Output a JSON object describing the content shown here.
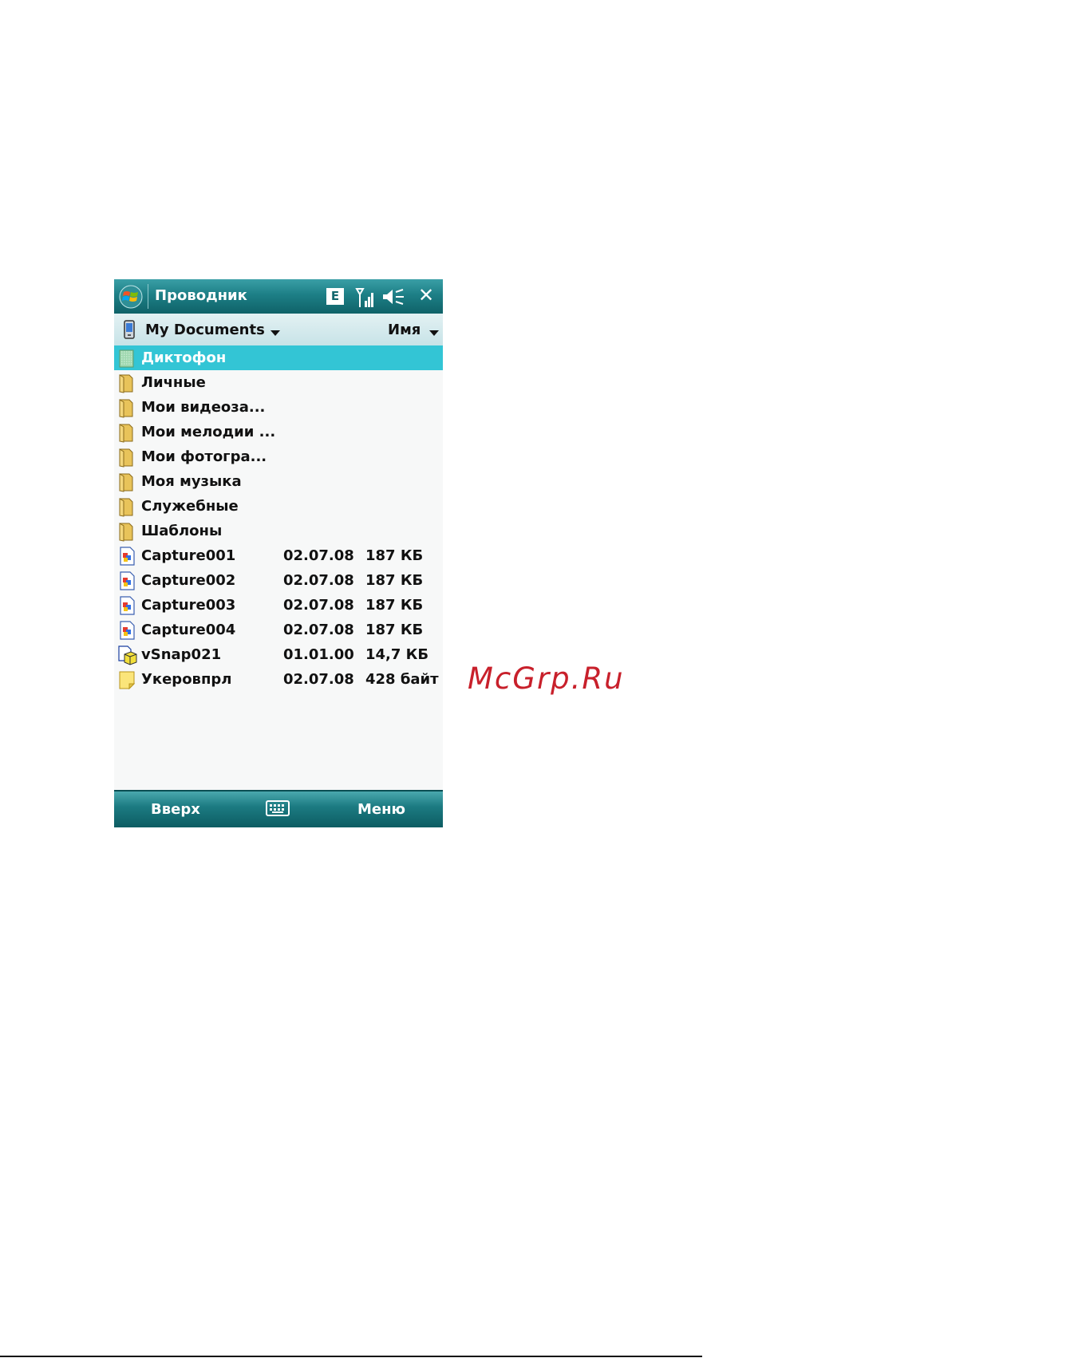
{
  "window": {
    "title": "Проводник",
    "tray_network_label": "E"
  },
  "location": {
    "folder": "My Documents",
    "sort_by": "Имя"
  },
  "files": [
    {
      "name": "Диктофон",
      "date": "",
      "size": "",
      "type": "recorder-folder",
      "selected": true
    },
    {
      "name": "Личные",
      "date": "",
      "size": "",
      "type": "folder"
    },
    {
      "name": "Мои видеоза...",
      "date": "",
      "size": "",
      "type": "folder"
    },
    {
      "name": "Мои мелодии ...",
      "date": "",
      "size": "",
      "type": "folder"
    },
    {
      "name": "Мои фотогра...",
      "date": "",
      "size": "",
      "type": "folder"
    },
    {
      "name": "Моя музыка",
      "date": "",
      "size": "",
      "type": "folder"
    },
    {
      "name": "Служебные",
      "date": "",
      "size": "",
      "type": "folder"
    },
    {
      "name": "Шаблоны",
      "date": "",
      "size": "",
      "type": "folder"
    },
    {
      "name": "Capture001",
      "date": "02.07.08",
      "size": "187 КБ",
      "type": "image"
    },
    {
      "name": "Capture002",
      "date": "02.07.08",
      "size": "187 КБ",
      "type": "image"
    },
    {
      "name": "Capture003",
      "date": "02.07.08",
      "size": "187 КБ",
      "type": "image"
    },
    {
      "name": "Capture004",
      "date": "02.07.08",
      "size": "187 КБ",
      "type": "image"
    },
    {
      "name": "vSnap021",
      "date": "01.01.00",
      "size": "14,7 КБ",
      "type": "program"
    },
    {
      "name": "Укеровпрл",
      "date": "02.07.08",
      "size": "428 байт",
      "type": "note"
    }
  ],
  "softkeys": {
    "left": "Вверх",
    "right": "Меню"
  },
  "watermark": "McGrp.Ru",
  "colors": {
    "titlebar": "#1d7f86",
    "selection": "#33c5d5",
    "watermark": "#c8202b",
    "folder": "#e8c35a"
  }
}
